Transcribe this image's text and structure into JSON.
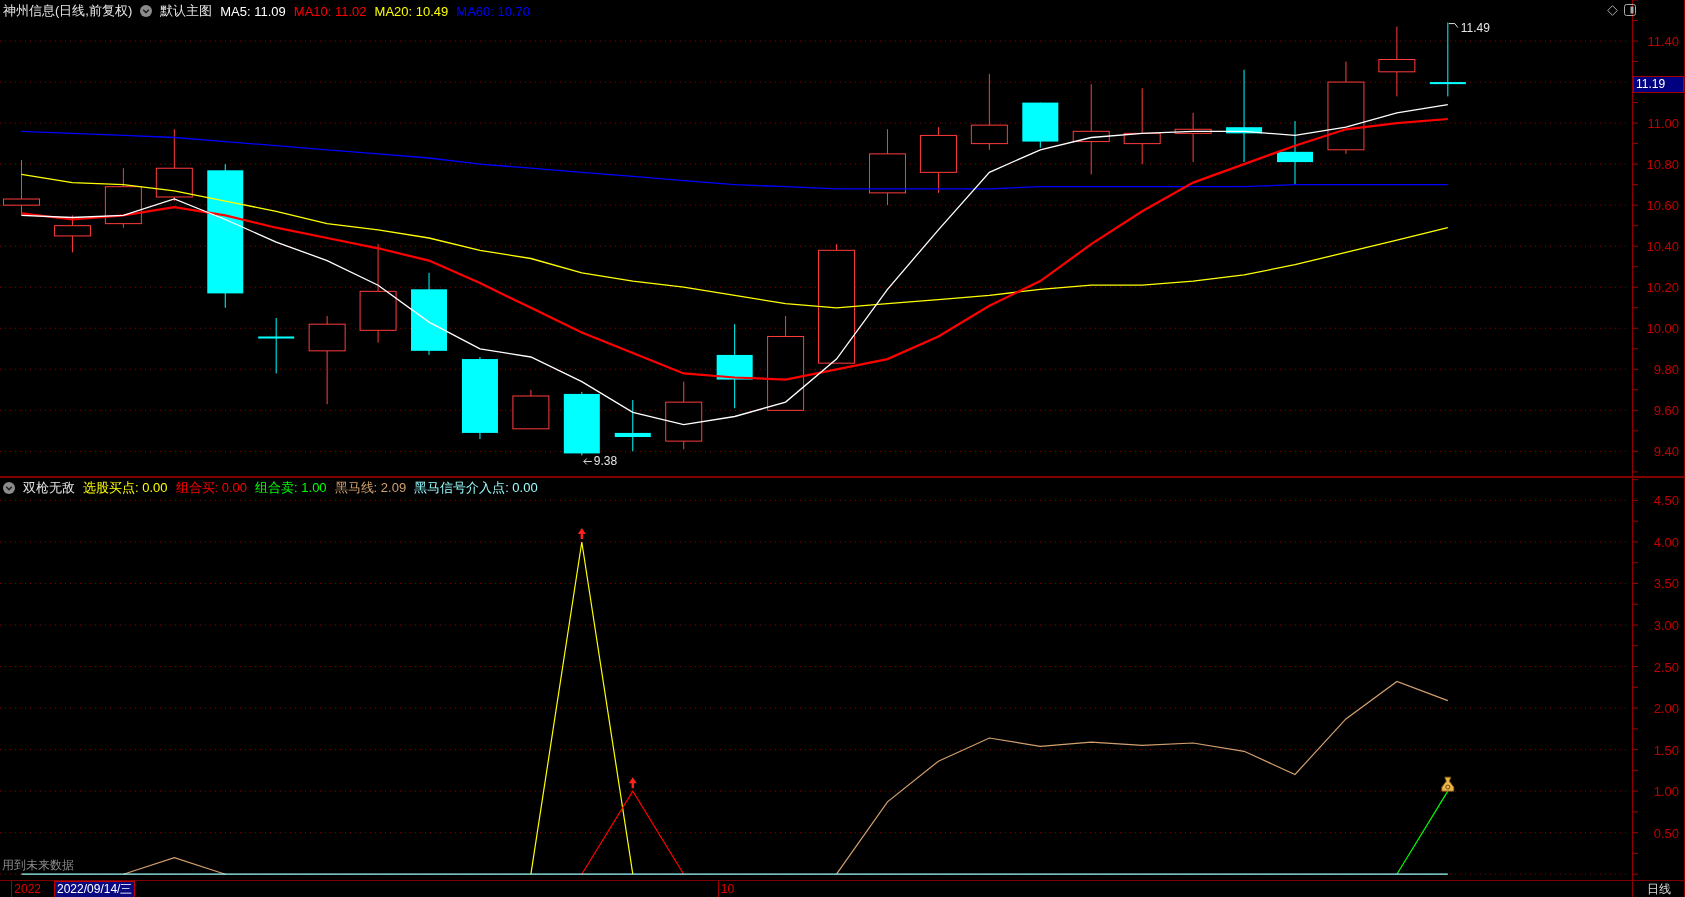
{
  "main_header": {
    "title": "神州信息(日线,前复权)",
    "template": "默认主图"
  },
  "main_chart": {
    "high_label": "11.49",
    "low_label": "9.38",
    "last_price": "11.19",
    "chart_data": {
      "type": "line",
      "ylim": [
        9.28,
        11.6
      ],
      "grid": true,
      "yticks": [
        {
          "value": 11.4,
          "label": "11.40"
        },
        {
          "value": 11.0,
          "label": "11.00"
        },
        {
          "value": 10.8,
          "label": "10.80"
        },
        {
          "value": 10.6,
          "label": "10.60"
        },
        {
          "value": 10.4,
          "label": "10.40"
        },
        {
          "value": 10.2,
          "label": "10.20"
        },
        {
          "value": 10.0,
          "label": "10.00"
        },
        {
          "value": 9.8,
          "label": "9.80"
        },
        {
          "value": 9.6,
          "label": "9.60"
        },
        {
          "value": 9.4,
          "label": "9.40"
        }
      ],
      "series": [
        {
          "name": "MA5: 11.09",
          "color": "#ffffff",
          "values": [
            10.55,
            10.54,
            10.55,
            10.63,
            10.53,
            10.42,
            10.33,
            10.21,
            10.03,
            9.9,
            9.86,
            9.74,
            9.59,
            9.53,
            9.57,
            9.64,
            9.85,
            10.19,
            10.48,
            10.76,
            10.87,
            10.93,
            10.95,
            10.96,
            10.96,
            10.94,
            10.98,
            11.05,
            11.09
          ]
        },
        {
          "name": "MA10: 11.02",
          "color": "#ff0000",
          "values": [
            10.56,
            10.53,
            10.55,
            10.59,
            10.55,
            10.49,
            10.44,
            10.39,
            10.33,
            10.22,
            10.1,
            9.98,
            9.88,
            9.78,
            9.76,
            9.75,
            9.8,
            9.85,
            9.96,
            10.11,
            10.23,
            10.41,
            10.57,
            10.71,
            10.8,
            10.89,
            10.97,
            11.0,
            11.02
          ]
        },
        {
          "name": "MA20: 10.49",
          "color": "#ffff00",
          "values": [
            10.75,
            10.71,
            10.7,
            10.67,
            10.62,
            10.57,
            10.51,
            10.48,
            10.44,
            10.38,
            10.34,
            10.27,
            10.23,
            10.2,
            10.16,
            10.12,
            10.1,
            10.12,
            10.14,
            10.16,
            10.19,
            10.21,
            10.21,
            10.23,
            10.26,
            10.31,
            10.37,
            10.43,
            10.49
          ]
        },
        {
          "name": "MA60: 10.70",
          "color": "#0000ff",
          "values": [
            10.96,
            10.95,
            10.94,
            10.93,
            10.91,
            10.89,
            10.87,
            10.85,
            10.83,
            10.8,
            10.78,
            10.76,
            10.74,
            10.72,
            10.7,
            10.69,
            10.68,
            10.68,
            10.68,
            10.68,
            10.69,
            10.69,
            10.69,
            10.69,
            10.69,
            10.7,
            10.7,
            10.7,
            10.7
          ]
        }
      ]
    }
  },
  "sub_header": {
    "title": "双枪无敌"
  },
  "sub_chart": {
    "notice": "用到未来数据",
    "chart_data": {
      "type": "line",
      "ylim": [
        -0.07,
        4.77
      ],
      "grid": true,
      "yticks": [
        {
          "value": 4.5,
          "label": "4.50"
        },
        {
          "value": 4.0,
          "label": "4.00"
        },
        {
          "value": 3.5,
          "label": "3.50"
        },
        {
          "value": 3.0,
          "label": "3.00"
        },
        {
          "value": 2.5,
          "label": "2.50"
        },
        {
          "value": 2.0,
          "label": "2.00"
        },
        {
          "value": 1.5,
          "label": "1.50"
        },
        {
          "value": 1.0,
          "label": "1.00"
        },
        {
          "value": 0.5,
          "label": "0.50"
        }
      ],
      "series": [
        {
          "name": "选股买点: 0.00",
          "color": "#ffff00",
          "values": [
            null,
            null,
            null,
            null,
            null,
            null,
            null,
            null,
            null,
            null,
            0,
            4.0,
            0,
            null,
            null,
            null,
            null,
            null,
            null,
            null,
            null,
            null,
            null,
            null,
            null,
            null,
            null,
            null,
            null
          ]
        },
        {
          "name": "组合买: 0.00",
          "color": "#ff0000",
          "values": [
            null,
            null,
            null,
            null,
            null,
            null,
            null,
            null,
            null,
            null,
            null,
            0,
            1.0,
            0,
            null,
            null,
            null,
            null,
            null,
            null,
            null,
            null,
            null,
            null,
            null,
            null,
            null,
            null,
            null
          ]
        },
        {
          "name": "组合卖: 1.00",
          "color": "#00ff00",
          "values": [
            null,
            null,
            null,
            null,
            null,
            null,
            null,
            null,
            null,
            null,
            null,
            null,
            null,
            null,
            null,
            null,
            null,
            null,
            null,
            null,
            null,
            null,
            null,
            null,
            null,
            null,
            null,
            0,
            1.0
          ]
        },
        {
          "name": "黑马线: 2.09",
          "color": "#d2a06e",
          "values": [
            null,
            null,
            0,
            0.2,
            0,
            null,
            null,
            null,
            null,
            null,
            null,
            null,
            null,
            null,
            null,
            null,
            0,
            0.87,
            1.36,
            1.64,
            1.54,
            1.59,
            1.55,
            1.58,
            1.48,
            1.2,
            1.87,
            2.32,
            2.09
          ]
        },
        {
          "name": "黑马信号介入点: 0.00",
          "color": "#99ffff",
          "values": [
            0,
            0,
            0,
            0,
            0,
            0,
            0,
            0,
            0,
            0,
            0,
            0,
            0,
            0,
            0,
            0,
            0,
            0,
            0,
            0,
            0,
            0,
            0,
            0,
            0,
            0,
            0,
            0,
            0
          ]
        }
      ]
    }
  },
  "time_axis": {
    "labels": [
      "2022",
      "10"
    ],
    "cursor_date": "2022/09/14/三",
    "period": "日线"
  }
}
